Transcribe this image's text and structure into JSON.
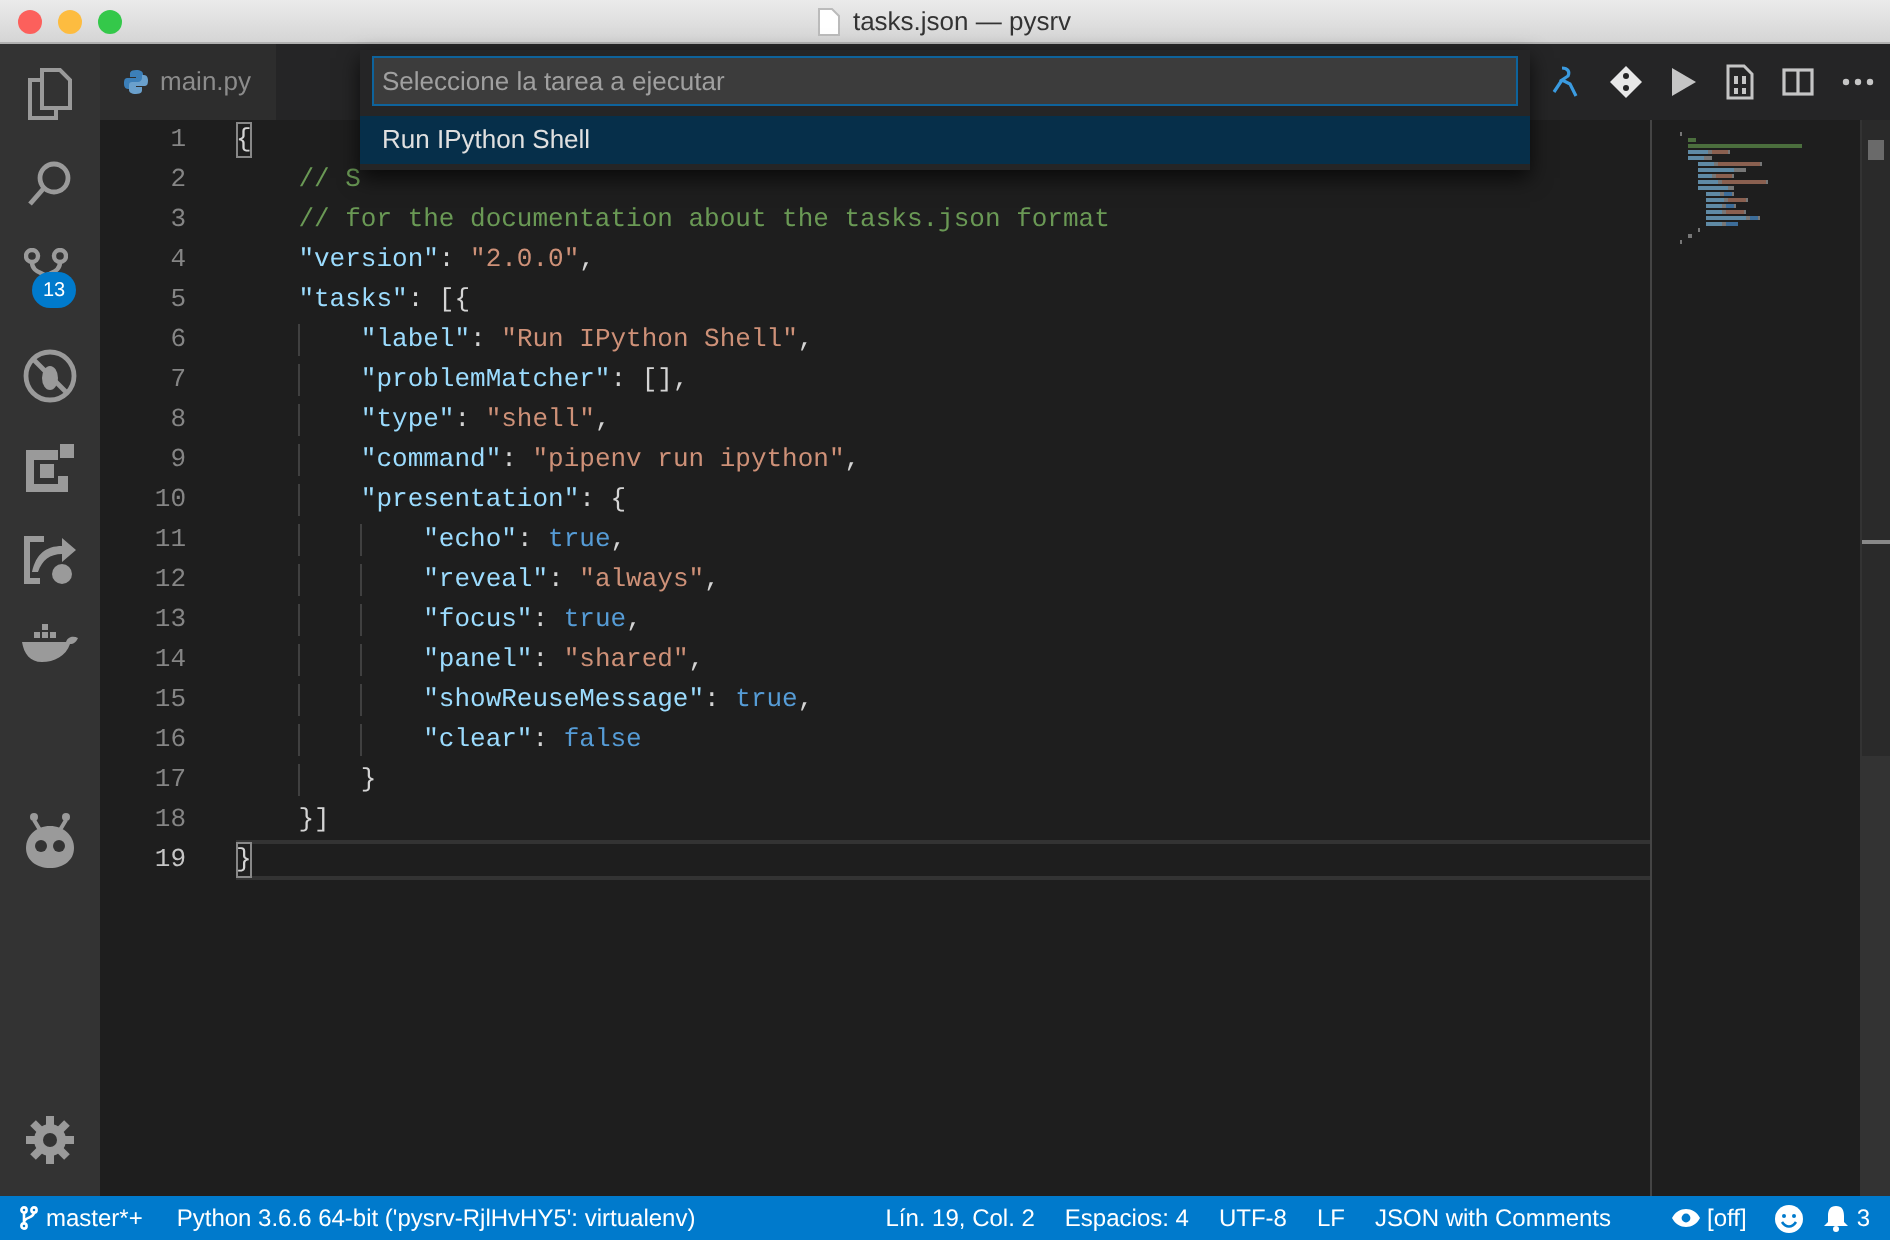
{
  "window": {
    "title": "tasks.json — pysrv"
  },
  "activity_bar": {
    "source_control_badge": "13"
  },
  "tabs": [
    {
      "label": "main.py",
      "selected": false
    }
  ],
  "quick_pick": {
    "placeholder": "Seleccione la tarea a ejecutar",
    "items": [
      {
        "label": "Run IPython Shell",
        "selected": true
      }
    ]
  },
  "editor": {
    "lines": [
      {
        "number": "1",
        "current": false,
        "tokens": [
          {
            "kind": "bracket",
            "text": "{"
          }
        ]
      },
      {
        "number": "2",
        "current": false,
        "tokens": [
          {
            "kind": "comment",
            "text": "    // S"
          }
        ]
      },
      {
        "number": "3",
        "current": false,
        "tokens": [
          {
            "kind": "comment",
            "text": "    // for the documentation about the tasks.json format"
          }
        ]
      },
      {
        "number": "4",
        "current": false,
        "tokens": [
          {
            "kind": "key",
            "text": "    \"version\""
          },
          {
            "kind": "punct",
            "text": ": "
          },
          {
            "kind": "string",
            "text": "\"2.0.0\""
          },
          {
            "kind": "punct",
            "text": ","
          }
        ]
      },
      {
        "number": "5",
        "current": false,
        "tokens": [
          {
            "kind": "key",
            "text": "    \"tasks\""
          },
          {
            "kind": "punct",
            "text": ": [{"
          }
        ]
      },
      {
        "number": "6",
        "current": false,
        "tokens": [
          {
            "kind": "key",
            "text": "        \"label\""
          },
          {
            "kind": "punct",
            "text": ": "
          },
          {
            "kind": "string",
            "text": "\"Run IPython Shell\""
          },
          {
            "kind": "punct",
            "text": ","
          }
        ]
      },
      {
        "number": "7",
        "current": false,
        "tokens": [
          {
            "kind": "key",
            "text": "        \"problemMatcher\""
          },
          {
            "kind": "punct",
            "text": ": [],"
          }
        ]
      },
      {
        "number": "8",
        "current": false,
        "tokens": [
          {
            "kind": "key",
            "text": "        \"type\""
          },
          {
            "kind": "punct",
            "text": ": "
          },
          {
            "kind": "string",
            "text": "\"shell\""
          },
          {
            "kind": "punct",
            "text": ","
          }
        ]
      },
      {
        "number": "9",
        "current": false,
        "tokens": [
          {
            "kind": "key",
            "text": "        \"command\""
          },
          {
            "kind": "punct",
            "text": ": "
          },
          {
            "kind": "string",
            "text": "\"pipenv run ipython\""
          },
          {
            "kind": "punct",
            "text": ","
          }
        ]
      },
      {
        "number": "10",
        "current": false,
        "tokens": [
          {
            "kind": "key",
            "text": "        \"presentation\""
          },
          {
            "kind": "punct",
            "text": ": {"
          }
        ]
      },
      {
        "number": "11",
        "current": false,
        "tokens": [
          {
            "kind": "key",
            "text": "            \"echo\""
          },
          {
            "kind": "punct",
            "text": ": "
          },
          {
            "kind": "keyword",
            "text": "true"
          },
          {
            "kind": "punct",
            "text": ","
          }
        ]
      },
      {
        "number": "12",
        "current": false,
        "tokens": [
          {
            "kind": "key",
            "text": "            \"reveal\""
          },
          {
            "kind": "punct",
            "text": ": "
          },
          {
            "kind": "string",
            "text": "\"always\""
          },
          {
            "kind": "punct",
            "text": ","
          }
        ]
      },
      {
        "number": "13",
        "current": false,
        "tokens": [
          {
            "kind": "key",
            "text": "            \"focus\""
          },
          {
            "kind": "punct",
            "text": ": "
          },
          {
            "kind": "keyword",
            "text": "true"
          },
          {
            "kind": "punct",
            "text": ","
          }
        ]
      },
      {
        "number": "14",
        "current": false,
        "tokens": [
          {
            "kind": "key",
            "text": "            \"panel\""
          },
          {
            "kind": "punct",
            "text": ": "
          },
          {
            "kind": "string",
            "text": "\"shared\""
          },
          {
            "kind": "punct",
            "text": ","
          }
        ]
      },
      {
        "number": "15",
        "current": false,
        "tokens": [
          {
            "kind": "key",
            "text": "            \"showReuseMessage\""
          },
          {
            "kind": "punct",
            "text": ": "
          },
          {
            "kind": "keyword",
            "text": "true"
          },
          {
            "kind": "punct",
            "text": ","
          }
        ]
      },
      {
        "number": "16",
        "current": false,
        "tokens": [
          {
            "kind": "key",
            "text": "            \"clear\""
          },
          {
            "kind": "punct",
            "text": ": "
          },
          {
            "kind": "keyword",
            "text": "false"
          }
        ]
      },
      {
        "number": "17",
        "current": false,
        "tokens": [
          {
            "kind": "punct",
            "text": "        }"
          }
        ]
      },
      {
        "number": "18",
        "current": false,
        "tokens": [
          {
            "kind": "punct",
            "text": "    }]"
          }
        ]
      },
      {
        "number": "19",
        "current": true,
        "tokens": [
          {
            "kind": "bracket",
            "text": "}"
          }
        ]
      }
    ]
  },
  "status_bar": {
    "branch": "master*+",
    "interpreter": "Python 3.6.6 64-bit ('pysrv-RjlHvHY5': virtualenv)",
    "position": "Lín. 19, Col. 2",
    "indentation": "Espacios: 4",
    "encoding": "UTF-8",
    "line_ending": "LF",
    "language": "JSON with Comments",
    "live_preview": "[off]",
    "notifications": "3"
  }
}
